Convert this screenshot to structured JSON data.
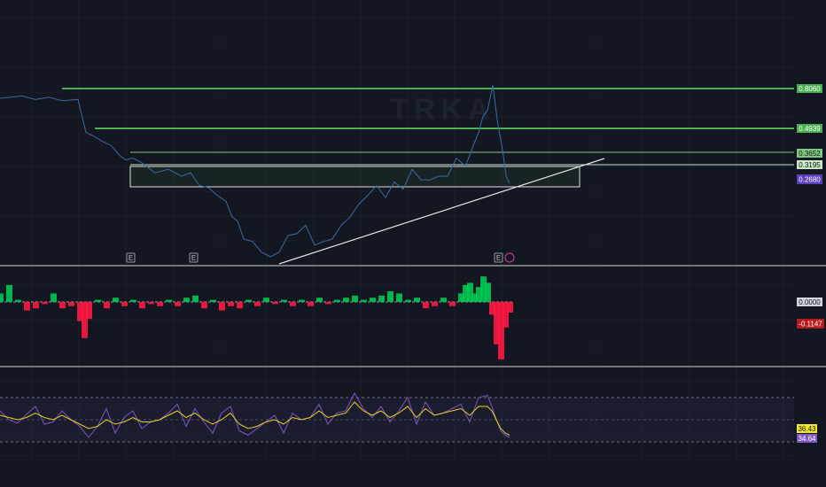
{
  "chart_data": {
    "type": "line",
    "price_panel": {
      "series": [
        {
          "x": [
            0,
            12,
            25,
            40,
            55,
            70,
            88,
            97,
            105,
            115,
            125,
            135,
            142,
            150,
            160,
            175,
            190,
            205,
            215,
            225,
            235,
            245,
            255,
            262,
            268,
            275,
            285,
            295,
            305,
            315,
            325,
            335,
            345,
            355,
            365,
            375,
            385,
            395,
            405,
            415,
            425,
            435,
            445,
            455,
            465,
            475,
            485,
            495,
            505,
            515,
            525,
            530,
            535,
            540,
            545,
            550,
            553,
            556,
            559,
            562,
            565,
            568,
            571,
            575
          ],
          "values": [
            0.7,
            0.74,
            0.72,
            0.72,
            0.71,
            0.71,
            0.69,
            0.48,
            0.44,
            0.43,
            0.39,
            0.36,
            0.33,
            0.35,
            0.32,
            0.3,
            0.3,
            0.29,
            0.29,
            0.26,
            0.23,
            0.21,
            0.17,
            0.13,
            0.11,
            0.08,
            0.07,
            0.06,
            0.05,
            0.06,
            0.08,
            0.09,
            0.1,
            0.07,
            0.07,
            0.08,
            0.1,
            0.13,
            0.16,
            0.21,
            0.24,
            0.2,
            0.26,
            0.24,
            0.3,
            0.28,
            0.27,
            0.29,
            0.28,
            0.35,
            0.31,
            0.36,
            0.4,
            0.48,
            0.56,
            0.63,
            0.7,
            0.84,
            0.64,
            0.52,
            0.42,
            0.36,
            0.28,
            0.27
          ]
        }
      ],
      "horizontal_levels": [
        {
          "value": 0.806,
          "label": "0.8060",
          "color": "#4caf50"
        },
        {
          "value": 0.4939,
          "label": "0.4939",
          "color": "#4caf50"
        },
        {
          "value": 0.3652,
          "label": "0.3652",
          "color": "#81c784"
        },
        {
          "value": 0.3195,
          "label": "0.3195",
          "color": "#c8e6c9"
        }
      ],
      "last_price": {
        "value": 0.268,
        "label": "0.2680",
        "color": "#5b3fbf"
      },
      "watermark": "TRKA",
      "event_markers": [
        "E",
        "E",
        "E"
      ]
    },
    "oscillator_panel": {
      "zero_label": "0.0000",
      "current_label": "-0.1147",
      "current_color": "#b71c1c",
      "positive_color": "#00c853",
      "negative_color": "#ff1744",
      "x": [
        0,
        10,
        20,
        30,
        40,
        50,
        60,
        70,
        80,
        90,
        95,
        100,
        110,
        120,
        130,
        140,
        150,
        160,
        170,
        180,
        190,
        200,
        210,
        220,
        230,
        240,
        250,
        260,
        270,
        280,
        290,
        300,
        310,
        320,
        330,
        340,
        350,
        360,
        370,
        380,
        390,
        400,
        410,
        420,
        430,
        440,
        450,
        460,
        470,
        480,
        490,
        500,
        510,
        520,
        525,
        530,
        535,
        540,
        545,
        550,
        555,
        560,
        565,
        570,
        575
      ],
      "values": [
        0.04,
        0.08,
        0.01,
        -0.04,
        -0.03,
        -0.01,
        0.04,
        -0.03,
        -0.02,
        -0.09,
        -0.17,
        -0.08,
        0.01,
        -0.03,
        0.02,
        -0.02,
        0.01,
        -0.03,
        -0.01,
        -0.02,
        0.01,
        -0.02,
        0.02,
        0.03,
        -0.03,
        0.01,
        -0.04,
        -0.02,
        -0.03,
        0.01,
        -0.02,
        0.02,
        -0.01,
        0.01,
        -0.02,
        0.01,
        -0.02,
        0.02,
        -0.01,
        0.01,
        0.02,
        0.03,
        0.01,
        0.02,
        0.03,
        0.05,
        0.04,
        0.01,
        0.02,
        -0.03,
        -0.02,
        0.02,
        -0.02,
        0.04,
        0.08,
        0.09,
        0.04,
        0.07,
        0.12,
        0.09,
        -0.06,
        -0.2,
        -0.27,
        -0.12,
        -0.05
      ]
    },
    "rsi_panel": {
      "rsi_label": "34.64",
      "rsi_color": "#7e57c2",
      "ma_label": "36.43",
      "ma_color": "#e8d21b",
      "x": [
        0,
        10,
        20,
        30,
        40,
        50,
        60,
        70,
        80,
        90,
        100,
        110,
        120,
        130,
        140,
        150,
        160,
        170,
        180,
        190,
        200,
        210,
        220,
        230,
        240,
        250,
        260,
        270,
        280,
        290,
        300,
        310,
        320,
        330,
        340,
        350,
        360,
        370,
        380,
        390,
        400,
        410,
        420,
        430,
        440,
        450,
        460,
        470,
        480,
        490,
        500,
        510,
        520,
        530,
        540,
        550,
        555,
        560,
        565,
        570,
        575
      ],
      "rsi": [
        58,
        50,
        47,
        55,
        62,
        46,
        48,
        58,
        50,
        44,
        34,
        44,
        60,
        38,
        52,
        58,
        42,
        48,
        50,
        56,
        64,
        44,
        60,
        48,
        38,
        56,
        62,
        40,
        36,
        42,
        48,
        54,
        38,
        56,
        50,
        52,
        64,
        46,
        56,
        58,
        74,
        60,
        52,
        62,
        48,
        58,
        70,
        46,
        66,
        54,
        56,
        60,
        64,
        48,
        70,
        72,
        62,
        50,
        40,
        36,
        34
      ],
      "ma": [
        54,
        52,
        50,
        52,
        56,
        52,
        50,
        54,
        50,
        46,
        42,
        44,
        50,
        46,
        48,
        52,
        48,
        48,
        50,
        54,
        58,
        52,
        56,
        50,
        46,
        50,
        56,
        46,
        42,
        44,
        48,
        50,
        46,
        52,
        50,
        52,
        58,
        52,
        54,
        56,
        66,
        58,
        54,
        58,
        52,
        56,
        62,
        52,
        60,
        54,
        56,
        58,
        60,
        54,
        62,
        62,
        58,
        50,
        42,
        38,
        36
      ]
    }
  }
}
